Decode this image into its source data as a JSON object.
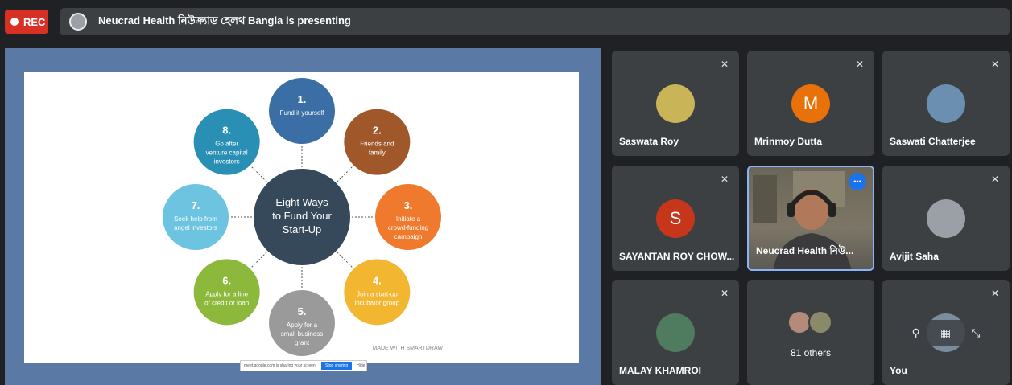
{
  "recording": {
    "label": "REC"
  },
  "presenter": {
    "text": "Neucrad Health নিউক্র্যাড হেলথ Bangla is presenting"
  },
  "slide": {
    "center_lines": [
      "Eight Ways",
      "to Fund Your",
      "Start-Up"
    ],
    "items": [
      {
        "num": "1.",
        "lines": [
          "Fund it yourself"
        ],
        "color": "#3a6ea5"
      },
      {
        "num": "2.",
        "lines": [
          "Friends and",
          "family"
        ],
        "color": "#a0572a"
      },
      {
        "num": "3.",
        "lines": [
          "Initiate a",
          "crowd-funding",
          "campaign"
        ],
        "color": "#ef7a2d"
      },
      {
        "num": "4.",
        "lines": [
          "Join a start-up",
          "incubator group"
        ],
        "color": "#f2b630"
      },
      {
        "num": "5.",
        "lines": [
          "Apply for a",
          "small business",
          "grant"
        ],
        "color": "#9a9a9a"
      },
      {
        "num": "6.",
        "lines": [
          "Apply for a line",
          "of credit or loan"
        ],
        "color": "#8cb83c"
      },
      {
        "num": "7.",
        "lines": [
          "Seek help from",
          "angel investors"
        ],
        "color": "#6cc4e0"
      },
      {
        "num": "8.",
        "lines": [
          "Go after",
          "venture capital",
          "investors"
        ],
        "color": "#2a8fb5"
      }
    ],
    "footer": "MADE WITH SMARTDRAW"
  },
  "share_bar": {
    "text": "meet.google.com is sharing your screen.",
    "stop": "Stop sharing",
    "hide": "Hide"
  },
  "tiles": [
    {
      "name": "Saswata Roy",
      "avatar_letter": "",
      "avatar_color": "#c9b458"
    },
    {
      "name": "Mrinmoy Dutta",
      "avatar_letter": "M",
      "avatar_color": "#e8710a"
    },
    {
      "name": "Saswati Chatterjee",
      "avatar_letter": "",
      "avatar_color": "#6a8fb0"
    },
    {
      "name": "SAYANTAN ROY CHOW...",
      "avatar_letter": "S",
      "avatar_color": "#c5361b"
    },
    {
      "name": "Neucrad Health নিউ...",
      "avatar_letter": "",
      "avatar_color": ""
    },
    {
      "name": "Avijit Saha",
      "avatar_letter": "",
      "avatar_color": "#9aa0a6"
    },
    {
      "name": "MALAY KHAMROI",
      "avatar_letter": "",
      "avatar_color": "#4f7b5e"
    },
    {
      "name": "",
      "avatar_letter": "",
      "avatar_color": ""
    },
    {
      "name": "You",
      "avatar_letter": "",
      "avatar_color": "#7a8c9e"
    }
  ],
  "others": {
    "label": "81 others"
  }
}
